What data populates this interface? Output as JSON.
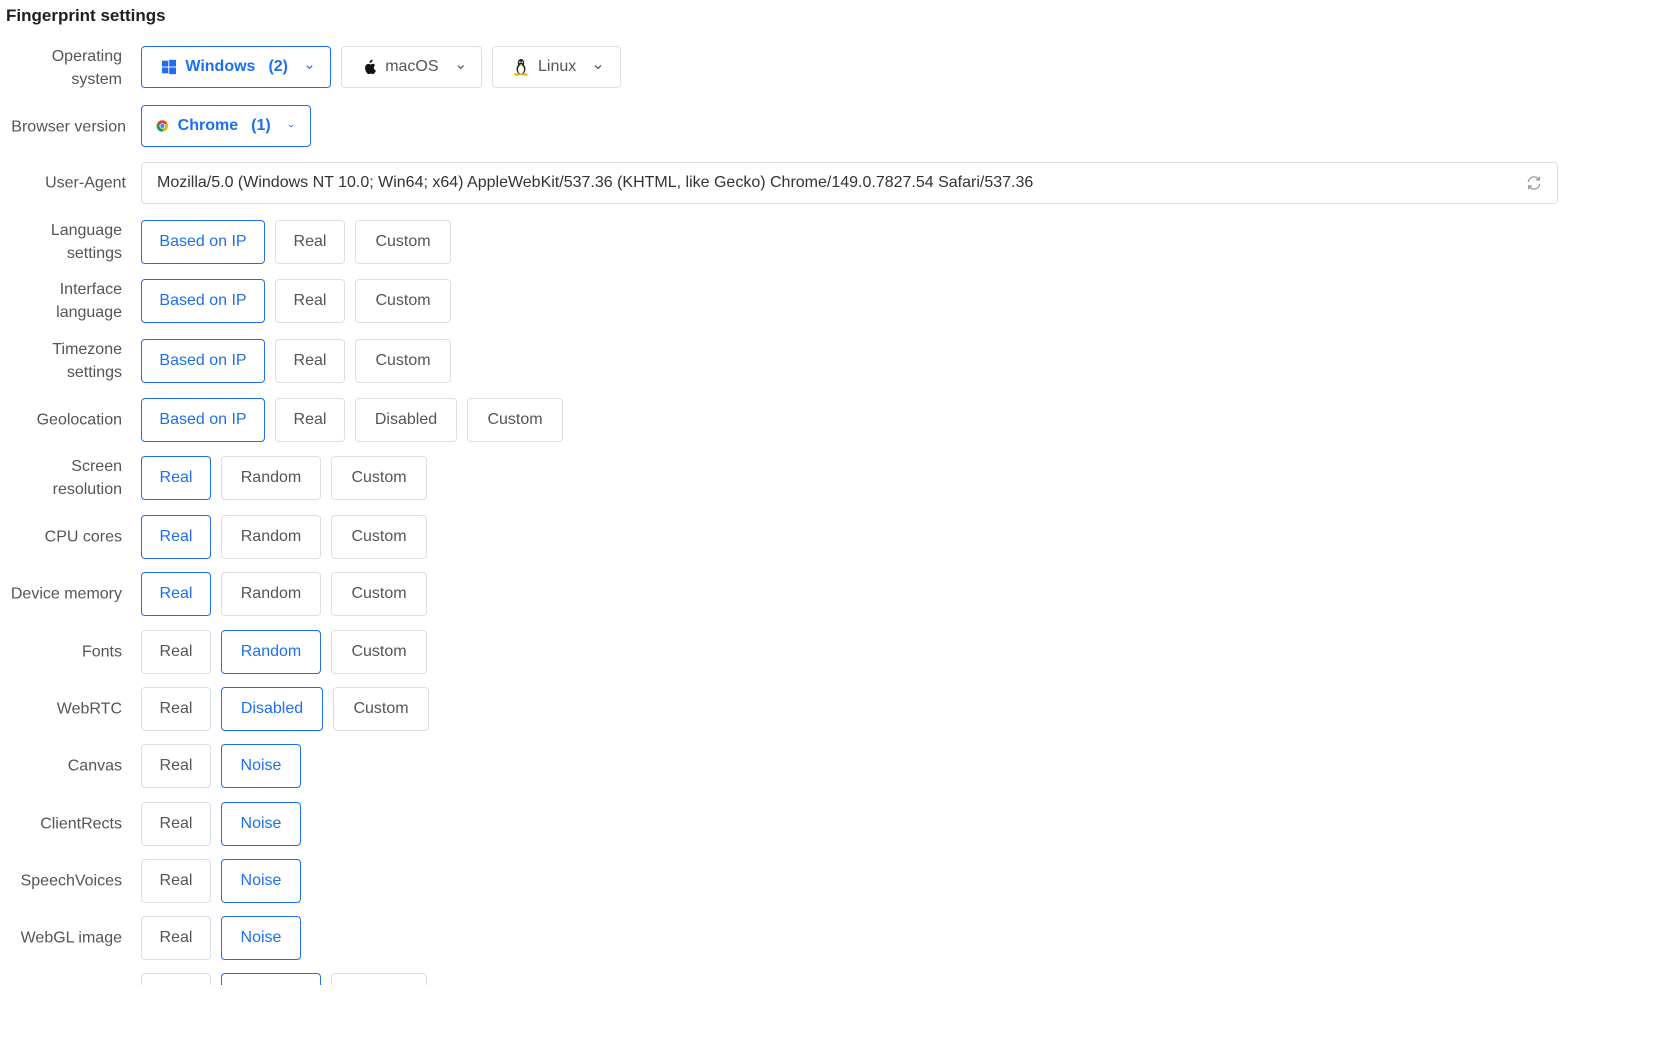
{
  "section_title": "Fingerprint settings",
  "os": {
    "label": "Operating system",
    "options": [
      {
        "name": "Windows",
        "count": "(2)",
        "icon": "windows-icon"
      },
      {
        "name": "macOS",
        "icon": "apple-icon"
      },
      {
        "name": "Linux",
        "icon": "linux-icon"
      }
    ]
  },
  "browser": {
    "label": "Browser version",
    "name": "Chrome",
    "count": "(1)",
    "icon": "chrome-icon"
  },
  "user_agent": {
    "label": "User-Agent",
    "value": "Mozilla/5.0 (Windows NT 10.0; Win64; x64) AppleWebKit/537.36 (KHTML, like Gecko) Chrome/149.0.7827.54 Safari/537.36",
    "icon": "refresh-icon"
  },
  "settings": [
    {
      "label": "Language settings",
      "options": [
        "Based on IP",
        "Real",
        "Custom"
      ],
      "selected": 0
    },
    {
      "label": "Interface language",
      "options": [
        "Based on IP",
        "Real",
        "Custom"
      ],
      "selected": 0
    },
    {
      "label": "Timezone settings",
      "options": [
        "Based on IP",
        "Real",
        "Custom"
      ],
      "selected": 0
    },
    {
      "label": "Geolocation",
      "options": [
        "Based on IP",
        "Real",
        "Disabled",
        "Custom"
      ],
      "selected": 0
    },
    {
      "label": "Screen resolution",
      "options": [
        "Real",
        "Random",
        "Custom"
      ],
      "selected": 0
    },
    {
      "label": "CPU cores",
      "options": [
        "Real",
        "Random",
        "Custom"
      ],
      "selected": 0
    },
    {
      "label": "Device memory",
      "options": [
        "Real",
        "Random",
        "Custom"
      ],
      "selected": 0
    },
    {
      "label": "Fonts",
      "options": [
        "Real",
        "Random",
        "Custom"
      ],
      "selected": 1
    },
    {
      "label": "WebRTC",
      "options": [
        "Real",
        "Disabled",
        "Custom"
      ],
      "selected": 1
    },
    {
      "label": "Canvas",
      "options": [
        "Real",
        "Noise"
      ],
      "selected": 1
    },
    {
      "label": "ClientRects",
      "options": [
        "Real",
        "Noise"
      ],
      "selected": 1
    },
    {
      "label": "SpeechVoices",
      "options": [
        "Real",
        "Noise"
      ],
      "selected": 1
    },
    {
      "label": "WebGL image",
      "options": [
        "Real",
        "Noise"
      ],
      "selected": 1
    }
  ],
  "colors": {
    "accent": "#1e6ff0",
    "border": "#dcdfe6",
    "label": "#555555"
  }
}
